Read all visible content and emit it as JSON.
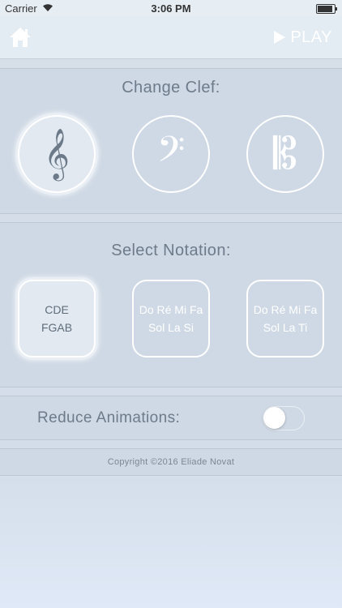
{
  "status_bar": {
    "carrier": "Carrier",
    "time": "3:06 PM",
    "battery_level": 1.0
  },
  "nav": {
    "home_icon": "home-icon",
    "play_label": "PLAY",
    "play_icon": "play-icon"
  },
  "clef_section": {
    "title": "Change Clef:",
    "options": [
      {
        "name": "treble",
        "glyph": "𝄞",
        "selected": true
      },
      {
        "name": "bass",
        "glyph": "𝄢",
        "selected": false
      },
      {
        "name": "alto",
        "glyph": "𝄡",
        "selected": false
      }
    ]
  },
  "notation_section": {
    "title": "Select Notation:",
    "options": [
      {
        "line1": "CDE",
        "line2": "FGAB",
        "selected": true
      },
      {
        "line1": "Do Ré Mi Fa",
        "line2": "Sol La Si",
        "selected": false
      },
      {
        "line1": "Do Ré Mi Fa",
        "line2": "Sol La Ti",
        "selected": false
      }
    ]
  },
  "animations": {
    "label": "Reduce Animations:",
    "enabled": false
  },
  "footer": {
    "copyright": "Copyright ©2016 Eliade Novat"
  },
  "colors": {
    "background": "#d3dde9",
    "panel": "#cfd9e5",
    "label_text": "#6d7b8a",
    "selected_glyph": "#6b7988",
    "white": "#ffffff"
  }
}
